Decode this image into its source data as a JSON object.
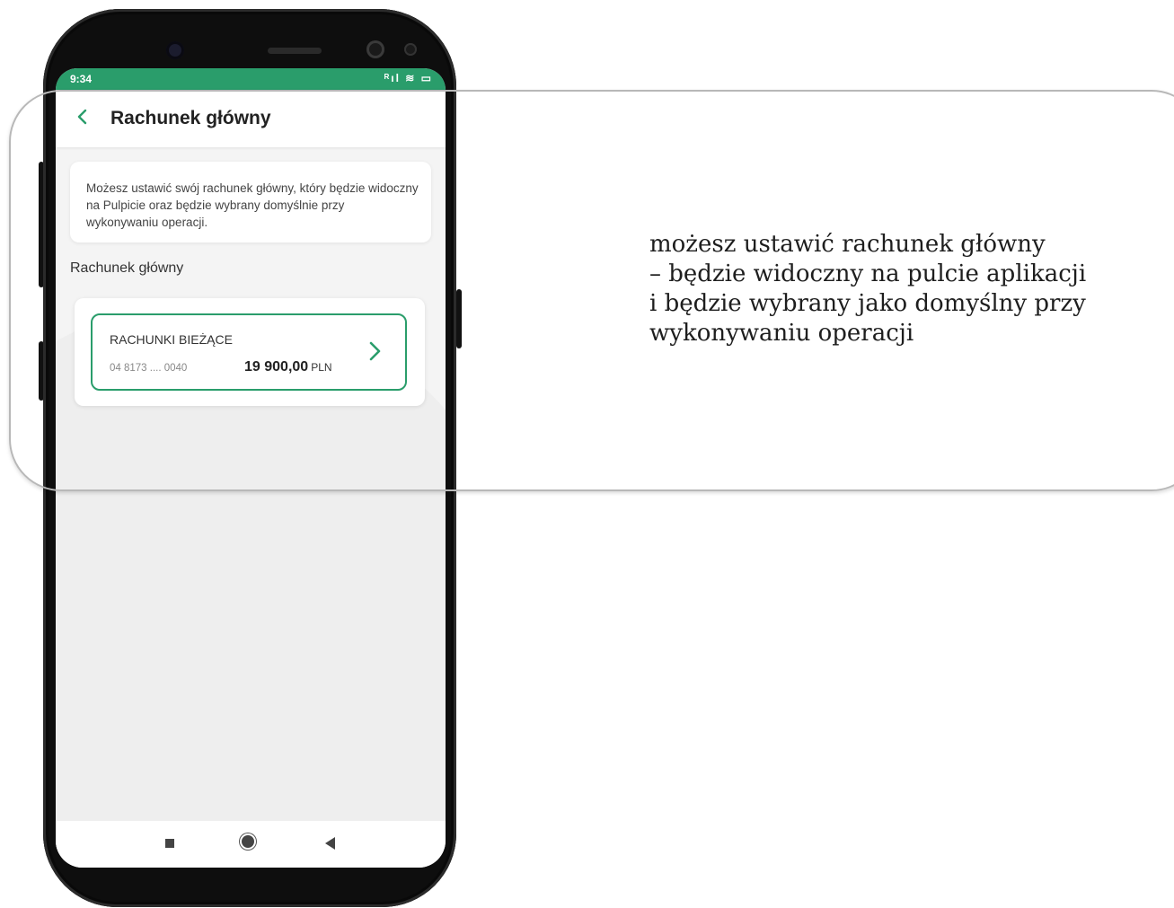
{
  "status_bar": {
    "time": "9:34",
    "icons": "ᴿıl ≋ ▭"
  },
  "header": {
    "title": "Rachunek główny",
    "back_icon": "chevron-left-icon"
  },
  "info_text": "Możesz ustawić swój rachunek główny, który będzie widoczny na Pulpicie oraz będzie wybrany domyślnie przy wykonywaniu operacji.",
  "section_label": "Rachunek główny",
  "account": {
    "name": "RACHUNKI BIEŻĄCE",
    "number": "04 8173 .... 0040",
    "amount": "19 900,00",
    "currency": "PLN"
  },
  "annotation": {
    "lines": [
      "możesz ustawić rachunek główny",
      "– będzie widoczny na pulcie aplikacji",
      "i będzie wybrany jako domyślny przy",
      "wykonywaniu operacji"
    ]
  },
  "colors": {
    "accent": "#2a9d6b",
    "screen_bg": "#f4f4f4",
    "phone": "#0e0e0e"
  }
}
